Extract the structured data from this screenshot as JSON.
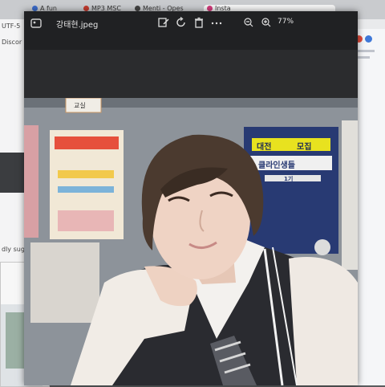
{
  "browser": {
    "tabs": [
      {
        "label": "A fun"
      },
      {
        "label": "MP3 MSC"
      },
      {
        "label": "Menti - Opes"
      },
      {
        "label": "Insta"
      }
    ],
    "left_text": {
      "top": "UTF-5",
      "mid": "Discor",
      "bottom": "dly sugg"
    }
  },
  "viewer": {
    "file_name": "강태현.jpeg",
    "zoom_level": "77%",
    "toolbar_icons": [
      "edit-icon",
      "rotate-icon",
      "delete-icon",
      "more-icon",
      "zoom-out-icon",
      "zoom-in-icon"
    ]
  },
  "photo": {
    "sign_label": "교실",
    "poster_lines": [
      "대전",
      "모집",
      "클라인생들",
      "1기"
    ]
  },
  "mini_window": {
    "close_glyph": "✕"
  }
}
